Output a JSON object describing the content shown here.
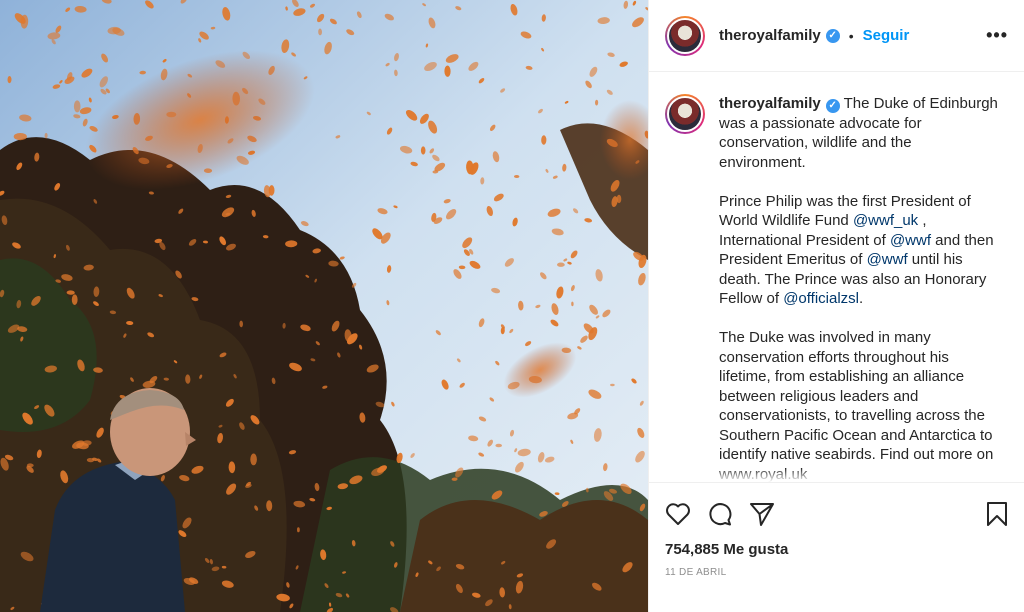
{
  "post": {
    "username": "theroyalfamily",
    "verified_mark": "✓",
    "separator": "•",
    "follow_label": "Seguir",
    "more_label": "•••",
    "photo_alt": "Prince Philip looking up at monarch butterflies"
  },
  "caption": {
    "username": "theroyalfamily",
    "p1": "The Duke of Edinburgh was a passionate advocate for conservation, wildlife and the environment.",
    "p2_a": "Prince Philip was the first President of World Wildlife Fund ",
    "p2_m1": "@wwf_uk",
    "p2_b": " , International President of ",
    "p2_m2": "@wwf",
    "p2_c": " and then President Emeritus of ",
    "p2_m3": "@wwf",
    "p2_d": " until his death. The Prince was also an Honorary Fellow of ",
    "p2_m4": "@officialzsl",
    "p2_e": ".",
    "p3": "The Duke was involved in many conservation efforts throughout his lifetime, from establishing an alliance between religious leaders and conservationists, to travelling across the Southern Pacific Ocean and Antarctica to identify native seabirds. Find out more on www.royal.uk"
  },
  "actions": {
    "likes": "754,885 Me gusta",
    "date": "11 de abril",
    "icons": [
      "heart-icon",
      "comment-icon",
      "share-icon",
      "bookmark-icon"
    ]
  },
  "colors": {
    "accent": "#0095f6",
    "mention": "#00376b",
    "text": "#262626",
    "muted": "#8e8e8e",
    "sky": "#bcd6ee",
    "butterfly": "#e0782c"
  }
}
